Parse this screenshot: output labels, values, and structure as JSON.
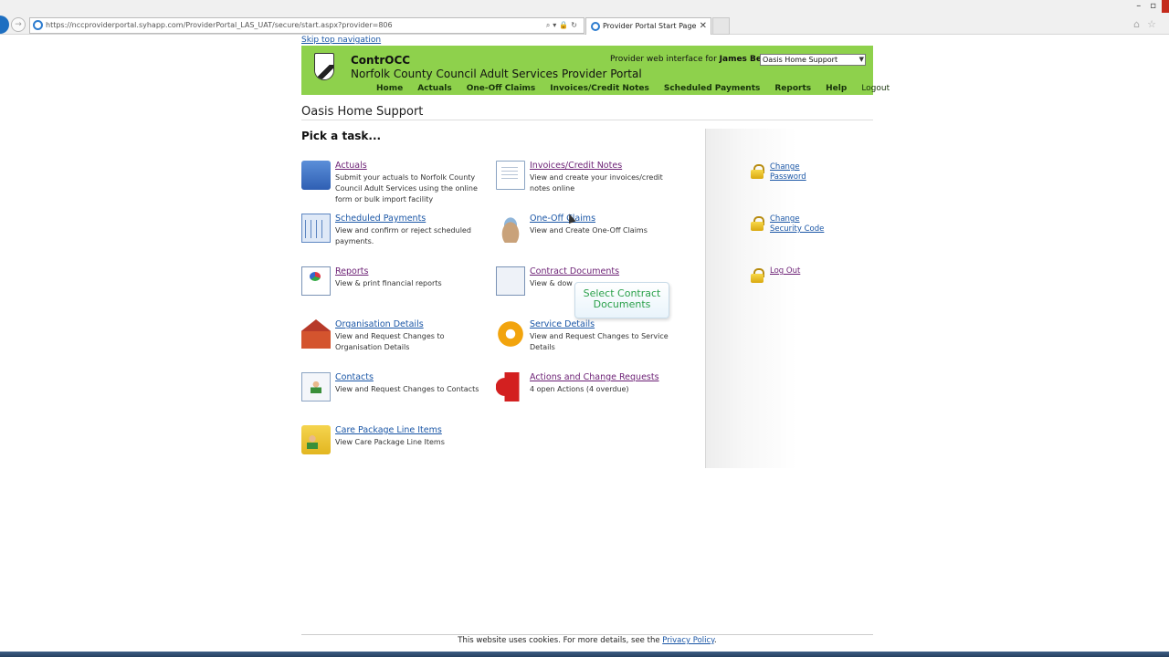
{
  "browser": {
    "url": "https://nccproviderportal.syhapp.com/ProviderPortal_LAS_UAT/secure/start.aspx?provider=806",
    "tab_title": "Provider Portal Start Page",
    "tab_close": "✕"
  },
  "page": {
    "skip_link": "Skip top navigation",
    "app_name": "ContrOCC",
    "portal_name": "Norfolk County Council Adult Services Provider Portal",
    "user_prefix": "Provider web interface for",
    "user_name": "James Beiley",
    "provider_select": "Oasis Home Support",
    "nav": [
      "Home",
      "Actuals",
      "One-Off Claims",
      "Invoices/Credit Notes",
      "Scheduled Payments",
      "Reports",
      "Help",
      "Logout"
    ],
    "title": "Oasis Home Support",
    "pick_task": "Pick a task...",
    "tasks": [
      {
        "label": "Actuals",
        "desc": "Submit your actuals to Norfolk County Council Adult Services using the online form or bulk import facility",
        "icon": "actuals-icon"
      },
      {
        "label": "Invoices/Credit Notes",
        "desc": "View and create your invoices/credit notes online",
        "icon": "invoice-icon"
      },
      {
        "label": "Scheduled Payments",
        "desc": "View and confirm or reject scheduled payments.",
        "icon": "calendar-icon"
      },
      {
        "label": "One-Off Claims",
        "desc": "View and Create One-Off Claims",
        "icon": "claims-icon"
      },
      {
        "label": "Reports",
        "desc": "View & print financial reports",
        "icon": "report-icon"
      },
      {
        "label": "Contract Documents",
        "desc": "View & dow",
        "icon": "contract-icon"
      },
      {
        "label": "Organisation Details",
        "desc": "View and Request Changes to Organisation Details",
        "icon": "organisation-icon"
      },
      {
        "label": "Service Details",
        "desc": "View and Request Changes to Service Details",
        "icon": "service-icon"
      },
      {
        "label": "Contacts",
        "desc": "View and Request Changes to Contacts",
        "icon": "contacts-icon"
      },
      {
        "label": "Actions and Change Requests",
        "desc": "4 open Actions (4 overdue)",
        "icon": "megaphone-icon"
      },
      {
        "label": "Care Package Line Items",
        "desc": "View Care Package Line Items",
        "icon": "folder-icon"
      }
    ],
    "side_links": [
      "Change Password",
      "Change Security Code",
      "Log Out"
    ],
    "tooltip": "Select Contract Documents",
    "footer_text": "This website uses cookies. For more details, see the",
    "footer_link": "Privacy Policy",
    "footer_end": "."
  }
}
